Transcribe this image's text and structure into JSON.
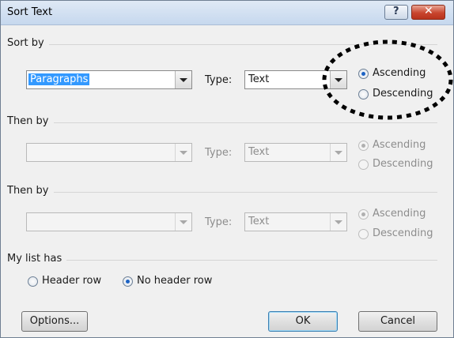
{
  "window": {
    "title": "Sort Text",
    "help_glyph": "?",
    "close_glyph": "✕"
  },
  "sort_by": {
    "heading": "Sort by",
    "field": "Paragraphs",
    "type_label": "Type:",
    "type_value": "Text",
    "ascending": "Ascending",
    "descending": "Descending",
    "selected": "ascending"
  },
  "then_by_1": {
    "heading": "Then by",
    "field": "",
    "type_label": "Type:",
    "type_value": "Text",
    "ascending": "Ascending",
    "descending": "Descending",
    "disabled": true
  },
  "then_by_2": {
    "heading": "Then by",
    "field": "",
    "type_label": "Type:",
    "type_value": "Text",
    "ascending": "Ascending",
    "descending": "Descending",
    "disabled": true
  },
  "my_list_has": {
    "heading": "My list has",
    "header_row": "Header row",
    "no_header_row": "No header row",
    "selected": "no_header_row"
  },
  "buttons": {
    "options": "Options...",
    "ok": "OK",
    "cancel": "Cancel"
  },
  "annotation": {
    "shape": "dotted-ellipse",
    "color": "#000000"
  }
}
